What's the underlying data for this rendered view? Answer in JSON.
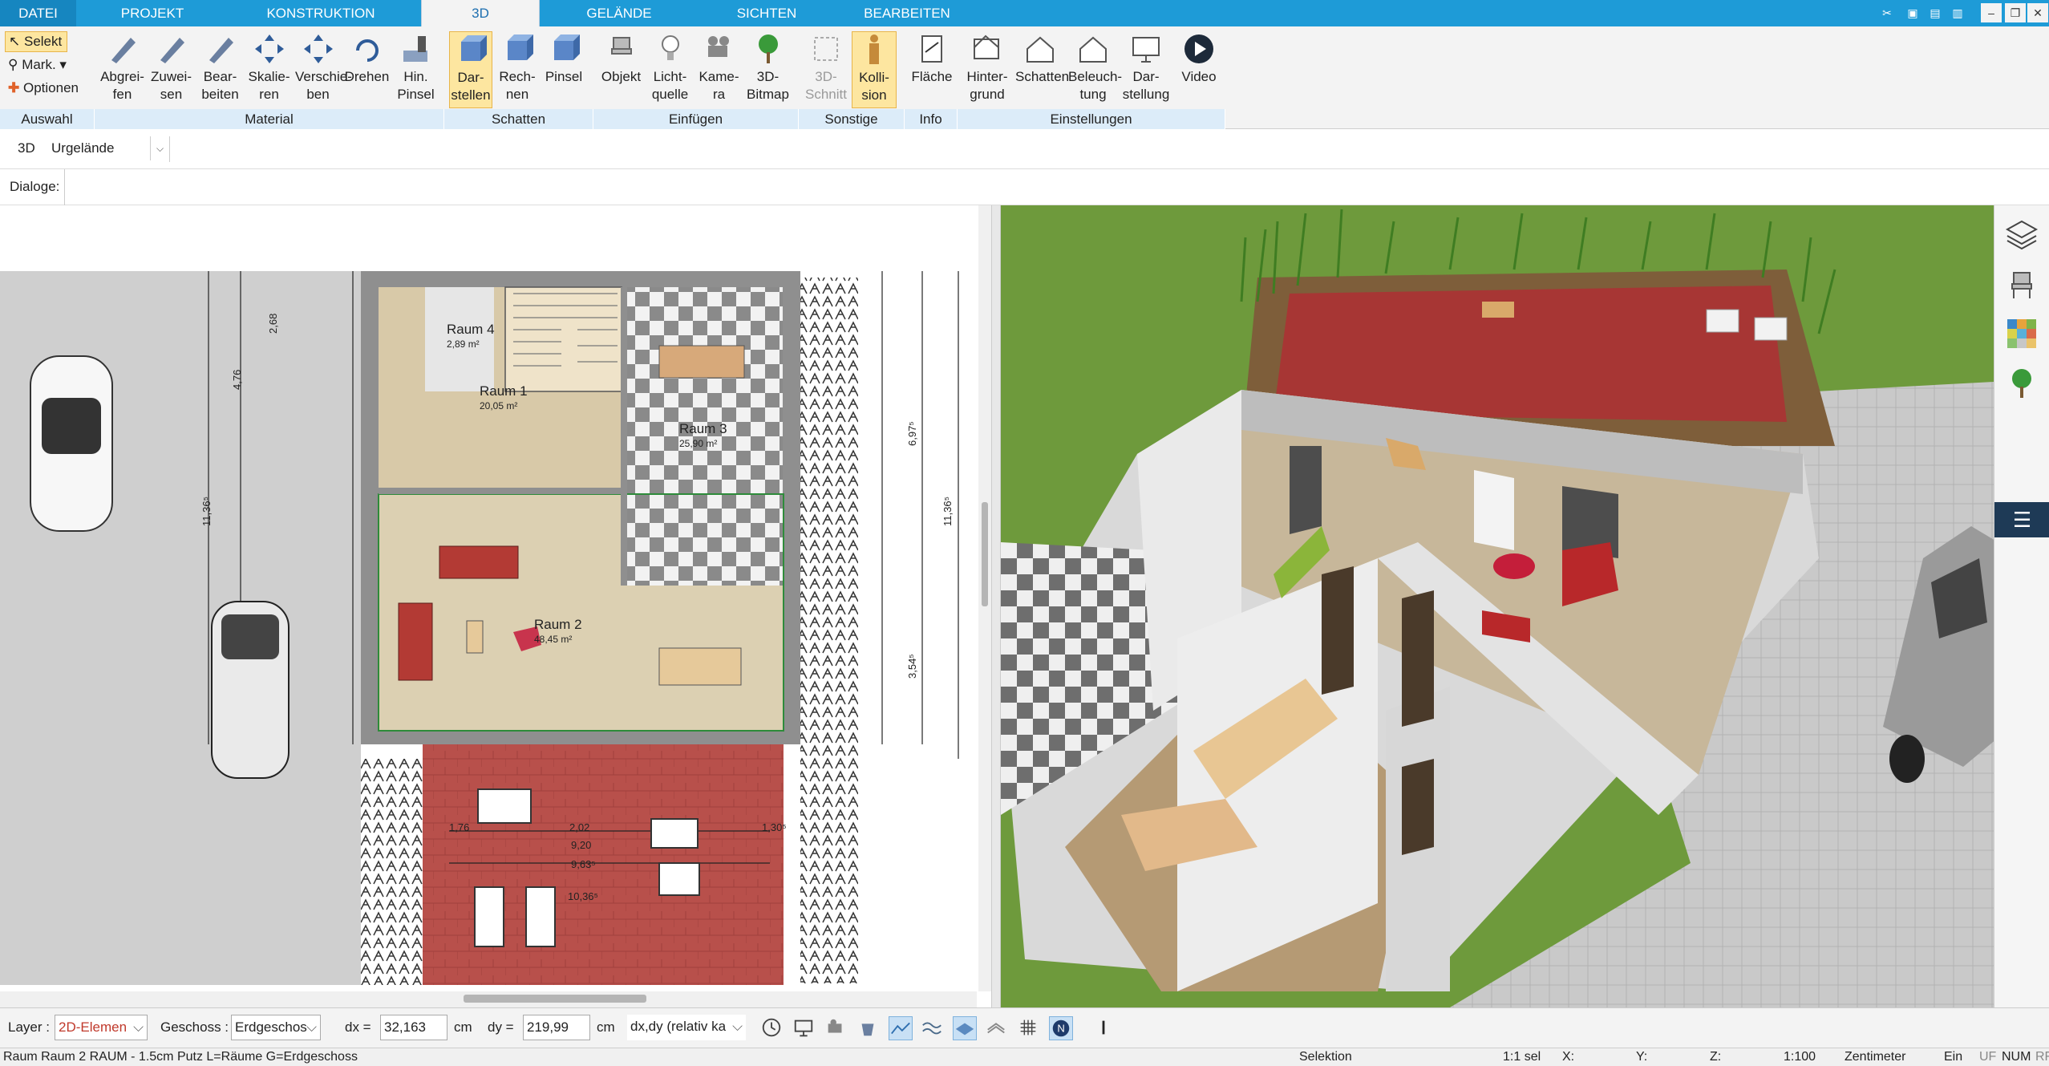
{
  "menu": {
    "tabs": [
      "DATEI",
      "PROJEKT",
      "KONSTRUKTION",
      "3D",
      "GELÄNDE",
      "SICHTEN",
      "BEARBEITEN"
    ],
    "active": "3D"
  },
  "ribbon": {
    "auswahl": {
      "label": "Auswahl",
      "selekt": "Selekt",
      "mark": "Mark.",
      "optionen": "Optionen"
    },
    "material": {
      "label": "Material",
      "buttons": [
        {
          "l1": "Abgrei-",
          "l2": "fen"
        },
        {
          "l1": "Zuwei-",
          "l2": "sen"
        },
        {
          "l1": "Bear-",
          "l2": "beiten"
        },
        {
          "l1": "Skalie-",
          "l2": "ren"
        },
        {
          "l1": "Verschie-",
          "l2": "ben"
        },
        {
          "l1": "Drehen",
          "l2": ""
        },
        {
          "l1": "Hin.",
          "l2": "Pinsel"
        }
      ]
    },
    "schatten": {
      "label": "Schatten",
      "buttons": [
        {
          "l1": "Dar-",
          "l2": "stellen"
        },
        {
          "l1": "Rech-",
          "l2": "nen"
        },
        {
          "l1": "Pinsel",
          "l2": ""
        }
      ]
    },
    "einfuegen": {
      "label": "Einfügen",
      "buttons": [
        {
          "l1": "Objekt",
          "l2": ""
        },
        {
          "l1": "Licht-",
          "l2": "quelle"
        },
        {
          "l1": "Kame-",
          "l2": "ra"
        },
        {
          "l1": "3D-",
          "l2": "Bitmap"
        }
      ]
    },
    "sonstige": {
      "label": "Sonstige",
      "buttons": [
        {
          "l1": "3D-",
          "l2": "Schnitt"
        },
        {
          "l1": "Kolli-",
          "l2": "sion"
        }
      ]
    },
    "info": {
      "label": "Info",
      "buttons": [
        {
          "l1": "Fläche",
          "l2": ""
        }
      ]
    },
    "einstellungen": {
      "label": "Einstellungen",
      "buttons": [
        {
          "l1": "Hinter-",
          "l2": "grund"
        },
        {
          "l1": "Schatten",
          "l2": ""
        },
        {
          "l1": "Beleuch-",
          "l2": "tung"
        },
        {
          "l1": "Dar-",
          "l2": "stellung"
        },
        {
          "l1": "Video",
          "l2": ""
        }
      ]
    }
  },
  "bar2": {
    "mode": "3D",
    "terrain": "Urgelände"
  },
  "bar3": {
    "dialoge": "Dialoge:"
  },
  "plan": {
    "rooms": [
      {
        "name": "Raum 4",
        "area": "2,89 m²"
      },
      {
        "name": "Raum 1",
        "area": "20,05 m²"
      },
      {
        "name": "Raum 3",
        "area": "25,90 m²"
      },
      {
        "name": "Raum 2",
        "area": "48,45 m²"
      }
    ],
    "dims": {
      "d1": "11,36⁵",
      "d2": "11,36⁵",
      "d3": "6,97⁵",
      "d4": "3,54⁵",
      "d5": "9,63⁵",
      "d6": "10,36⁵",
      "d7": "2,02",
      "d8": "1,76",
      "d9": "2,68",
      "d10": "4,76",
      "d11": "1,30⁵",
      "d12": "9,20"
    }
  },
  "toolbar": {
    "layer_label": "Layer :",
    "layer_value": "2D-Elemen",
    "geschoss_label": "Geschoss :",
    "geschoss_value": "Erdgeschos",
    "dx_label": "dx =",
    "dx_value": "32,163",
    "dx_unit": "cm",
    "dy_label": "dy =",
    "dy_value": "219,99",
    "dy_unit": "cm",
    "mode_value": "dx,dy (relativ ka"
  },
  "status": {
    "info": "Raum Raum 2 RAUM - 1.5cm Putz L=Räume G=Erdgeschoss",
    "selektion": "Selektion",
    "sel": "1:1 sel",
    "x": "X:",
    "y": "Y:",
    "z": "Z:",
    "scale": "1:100",
    "unit": "Zentimeter",
    "ein": "Ein",
    "uf": "UF",
    "num": "NUM",
    "rf": "RF"
  },
  "colors": {
    "accent": "#1e9bd7",
    "ribbon_group": "#dcecf9",
    "selected": "#fde6a0",
    "terrace": "#b8423f",
    "grass": "#5f8a2b"
  }
}
